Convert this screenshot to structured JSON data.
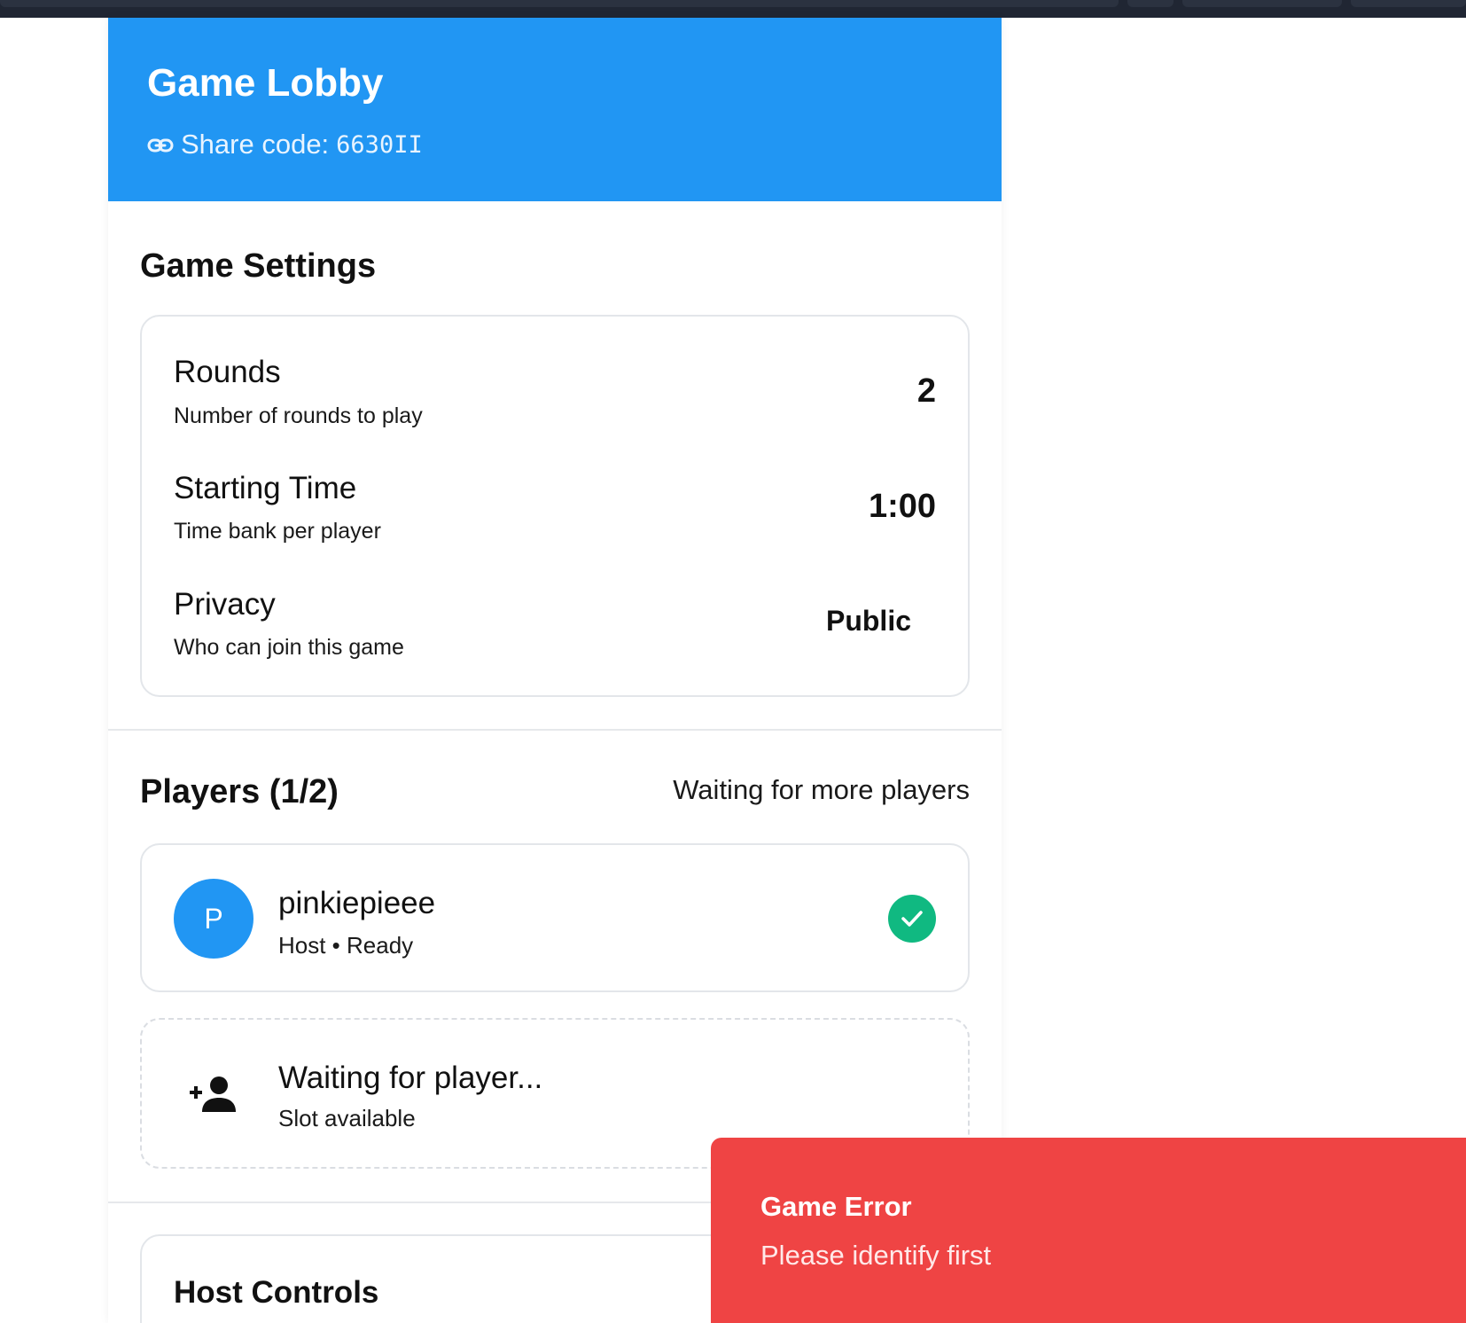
{
  "header": {
    "title": "Game Lobby",
    "share_label": "Share code:",
    "share_code": "6630II"
  },
  "settings": {
    "title": "Game Settings",
    "items": [
      {
        "label": "Rounds",
        "description": "Number of rounds to play",
        "value": "2"
      },
      {
        "label": "Starting Time",
        "description": "Time bank per player",
        "value": "1:00"
      },
      {
        "label": "Privacy",
        "description": "Who can join this game",
        "value": "Public"
      }
    ]
  },
  "players": {
    "title": "Players (1/2)",
    "status": "Waiting for more players",
    "list": [
      {
        "initial": "P",
        "name": "pinkiepieee",
        "meta": "Host • Ready"
      }
    ],
    "empty_slot": {
      "title": "Waiting for player...",
      "description": "Slot available"
    }
  },
  "host_controls": {
    "title": "Host Controls"
  },
  "toast": {
    "title": "Game Error",
    "message": "Please identify first",
    "color": "#ef4444"
  },
  "colors": {
    "primary": "#2196f3",
    "success": "#10b981",
    "error": "#ef4444"
  },
  "icons": {
    "share": "link-icon",
    "ready": "check-icon",
    "add_player": "add-user-icon"
  }
}
